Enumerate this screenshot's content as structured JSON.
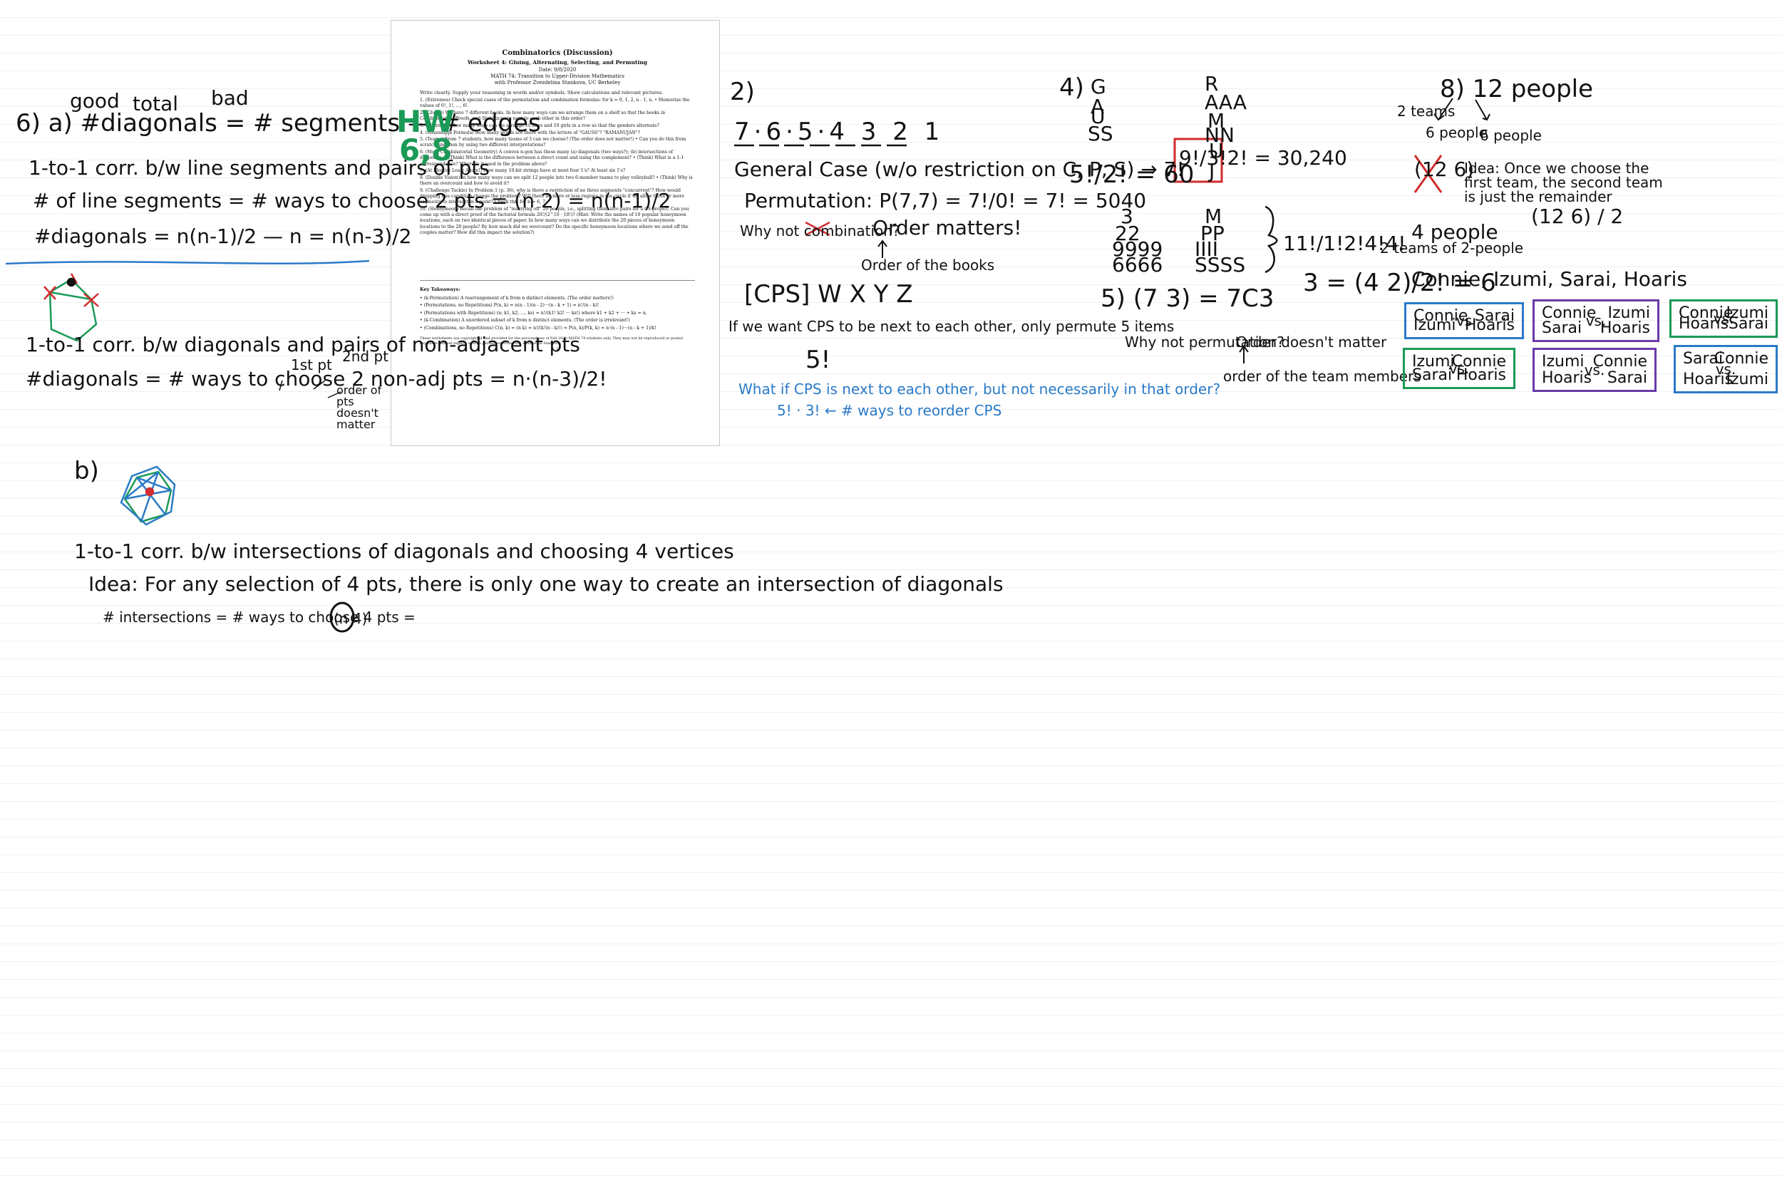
{
  "colors": {
    "ink": "#111111",
    "blue_ink": "#2a7ac8",
    "green_ink": "#1b9a57",
    "red_ink": "#d22c2c",
    "purple_ink": "#6a3aa8",
    "page_line": "#eef0f3"
  },
  "worksheet": {
    "title": "Combinatorics (Discussion)",
    "subtitle": "Worksheet 4: Gluing, Alternating, Selecting, and Permuting",
    "date": "Date: 9/8/2020",
    "course": "MATH 74: Transition to Upper-Division Mathematics",
    "professor": "with Professor Zvezdelina Stankova, UC Berkeley",
    "write_line": "Write clearly. Supply your reasoning in words and/or symbols. Show calculations and relevant pictures.",
    "problems": [
      "1. (Extremes) Check special cases of the permutation and combination formulas: for k = 0, 1, 2, n - 1, n.  • Memorize the values of 0!, 1!, ..., 6!.",
      "2. (Gluing) We have 7 different books. In how many ways can we arrange them on a shelf so that the books in Combinatorics, Proofs, and Statistics are next to each other in this order?",
      "3. (Alternate) How many ways can we arrange 10 boys and 10 girls in a row so that the genders alternate?",
      "4. (Mississippi Formula) How many words are there with the letters of \"GAUSS\"? \"RAMANUJAN\"?",
      "5. (Teams) From 7 students, how many teams of 3 can we choose? (The order does not matter!)  • Can you do this from scratch and then by using two different interpretations?",
      "6. (More Combinatorial Geometry) A convex n-gon has these many (a) diagonals (two ways?); (b) intersections of diagonals.  • (Think) What is the difference between a direct count and using the complement?  • (Think) What is a 1-1 correspondence? Where is it used in the problem above?",
      "7. (At Most/at Least Again!) How many 10-bit strings have at most four 1's? At least six 1's?",
      "8. (Double Vision) In how many ways can we split 12 people into two 6-member teams to play volleyball?  • (Think) Why is there an overcount and how to avoid it?",
      "9. (Challenge Tackle) In Problem 1 (p. 36), why is there a restriction of no three segments \"concurrent\"? How would dropping this condition change the problem? Will there be more or less regions in the circle if we allow three or more segments to intersect in a point? Check this for n = 6, 7.",
      "10. (Honeymoon) Recall the problem of \"marrying off\" 20 people, i.e., splitting them into pairs for a CS project. Can you come up with a direct proof of the factorial formula 20!/(2^10 · 10!)?  (Hint: Write the names of 10 popular honeymoon locations, each on two identical pieces of paper. In how many ways can we distribute the 20 pieces of honeymoon locations to the 20 people? By how much did we overcount? Do the specific honeymoon locations where we send off the couples matter? How did this impact the solution?)"
    ],
    "key_title": "Key Takeaways:",
    "takeaways": [
      "• (k-Permutation) A rearrangement of k from n distinct elements. (The order matters!)",
      "• (Permutations, no Repetitions) P(n, k) = n(n - 1)(n - 2)···(n - k + 1) = n!/(n - k)!",
      "• (Permutations with Repetitions) (n; k1, k2, ..., ks) = n!/(k1! k2! ··· ks!) where k1 + k2 + ··· + ks = n.",
      "• (k-Combination) A unordered subset of k from n distinct elements. (The order is irrelevant!)",
      "• (Combinations, no Repetitions) C(n, k) = (n k) = n!/(k!(n - k)!) = P(n, k)/P(k, k) = n·(n - 1)···(n - k + 1)/k!"
    ],
    "footnote": "These worksheets are copyrighted and provided for the personal use of Fall 2020 MATH 74 students only. They may not be reproduced or posted anywhere without explicit written permission from Prof. Zvezdelina Stankova.",
    "page": "1"
  },
  "notes": {
    "p6": {
      "above": [
        "good",
        "total",
        "bad"
      ],
      "formula": "6) a) #diagonals = # segments — # edges",
      "corr1": "1-to-1 corr. b/w line segments and pairs of pts",
      "segments": "# of line segments = # ways to choose 2 pts = (n 2) = n(n-1)/2",
      "diag": "#diagonals = n(n-1)/2 — n = n(n-3)/2",
      "corr2": "1-to-1 corr. b/w diagonals and pairs of non-adjacent pts",
      "diag2": "#diagonals = # ways to choose 2 non-adj pts = n·(n-3)/2!",
      "first_pt": "1st pt",
      "second_pt": "2nd pt",
      "order_note": "order of pts doesn't matter"
    },
    "hw": {
      "label": "HW",
      "nums": "6,8"
    },
    "p6b": {
      "label": "b)",
      "corr": "1-to-1 corr. b/w intersections of diagonals and choosing 4 vertices",
      "idea": "Idea: For any selection of 4 pts, there is only one way to create an intersection of diagonals",
      "count": "# intersections = # ways to choose 4 pts =",
      "binom": "(n 4)"
    },
    "p2": {
      "label": "2)",
      "slots": "7·6·5·4 3 2 1",
      "general": "General Case (w/o restriction on C, P, S) → 7!",
      "perm": "Permutation: P(7,7) = 7!/0! = 7! = 5040",
      "why": "Why not combination?",
      "order": "Order matters!",
      "order_books": "Order of the books",
      "glue": "[CPS] W X Y Z",
      "glue_note": "If we want CPS to be next to each other, only permute 5 items",
      "five": "5!",
      "blue_q": "What if CPS is next to each other, but not necessarily in that order?",
      "blue_a": "5! · 3! ← # ways to reorder CPS"
    },
    "p4": {
      "label": "4)",
      "gauss": [
        "G",
        "A",
        "U",
        "SS"
      ],
      "gauss_eq": "5!/2! = 60",
      "raman": [
        "R",
        "AAA",
        "M",
        "NN",
        "U",
        "J"
      ],
      "raman_eq": "9!/3!2! = 30,240",
      "miss_left": [
        "3",
        "22",
        "9999",
        "6666"
      ],
      "miss_mid": [
        "M",
        "PP",
        "IIII",
        "SSSS"
      ],
      "miss_eq": "11!/1!2!4!4!"
    },
    "p5": {
      "eq": "5) (7 3) = 7C3",
      "why": "Why not permutation?",
      "order": "Order doesn't matter",
      "order2": "order of the team members"
    },
    "p8": {
      "title": "8) 12 people",
      "teams": "2 teams",
      "six1": "6 people",
      "six2": "6 people",
      "binom": "(12 6)",
      "idea": "Idea: Once we choose the first team, the second team is just the remainder",
      "four": "4 people",
      "two_teams": "2 teams of 2-people",
      "three": "3 = (4 2)/2! = 6",
      "frac": "(12 6) / 2",
      "names": "Connie, Izumi, Sarai, Hoaris",
      "boxes": [
        {
          "tl": "Connie",
          "bl": "Izumi",
          "vs": "vs",
          "tr": "Sarai",
          "br": "Hoaris"
        },
        {
          "tl": "Connie",
          "bl": "Sarai",
          "vs": "vs.",
          "tr": "Izumi",
          "br": "Hoaris"
        },
        {
          "tl": "Connie",
          "bl": "Hoaris",
          "vs": "vs.",
          "tr": "Izumi",
          "br": "Sarai"
        },
        {
          "tl": "Izumi",
          "bl": "Sarai",
          "vs": "vs.",
          "tr": "Connie",
          "br": "Hoaris"
        },
        {
          "tl": "Izumi",
          "bl": "Hoaris",
          "vs": "vs.",
          "tr": "Connie",
          "br": "Sarai"
        },
        {
          "tl": "Sarai",
          "bl": "Hoaris",
          "vs": "vs.",
          "tr": "Connie",
          "br": "Izumi"
        }
      ]
    }
  }
}
